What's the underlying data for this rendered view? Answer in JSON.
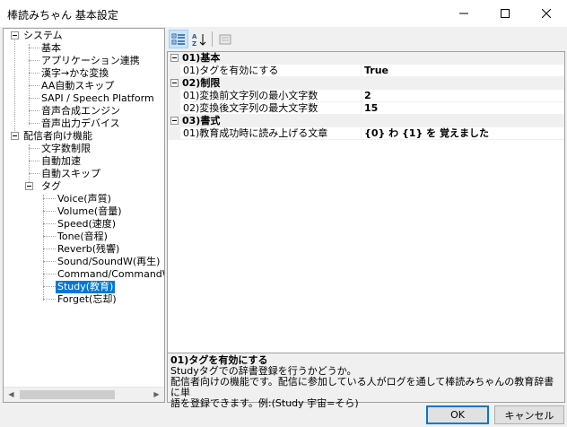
{
  "window": {
    "title": "棒読みちゃん 基本設定"
  },
  "tree": {
    "nodes": [
      {
        "label": "システム"
      },
      {
        "label": "基本"
      },
      {
        "label": "アプリケーション連携"
      },
      {
        "label": "漢字→かな変換"
      },
      {
        "label": "AA自動スキップ"
      },
      {
        "label": "SAPI / Speech Platform"
      },
      {
        "label": "音声合成エンジン"
      },
      {
        "label": "音声出力デバイス"
      },
      {
        "label": "配信者向け機能"
      },
      {
        "label": "文字数制限"
      },
      {
        "label": "自動加速"
      },
      {
        "label": "自動スキップ"
      },
      {
        "label": "タグ"
      },
      {
        "label": "Voice(声質)"
      },
      {
        "label": "Volume(音量)"
      },
      {
        "label": "Speed(速度)"
      },
      {
        "label": "Tone(音程)"
      },
      {
        "label": "Reverb(残響)"
      },
      {
        "label": "Sound/SoundW(再生)"
      },
      {
        "label": "Command/CommandW"
      },
      {
        "label": "Study(教育)"
      },
      {
        "label": "Forget(忘却)"
      }
    ],
    "selected": "Study(教育)"
  },
  "property_grid": {
    "categories": [
      {
        "label": "01)基本",
        "props": [
          {
            "name": "01)タグを有効にする",
            "value": "True"
          }
        ]
      },
      {
        "label": "02)制限",
        "props": [
          {
            "name": "01)変換前文字列の最小文字数",
            "value": "2"
          },
          {
            "name": "02)変換後文字列の最大文字数",
            "value": "15"
          }
        ]
      },
      {
        "label": "03)書式",
        "props": [
          {
            "name": "01)教育成功時に読み上げる文章",
            "value": "{0} わ {1} を 覚えました"
          }
        ]
      }
    ]
  },
  "description": {
    "title": "01)タグを有効にする",
    "line1": "Studyタグでの辞書登録を行うかどうか。",
    "line2": "配信者向けの機能です。配信に参加している人がログを通して棒読みちゃんの教育辞書に単",
    "line3": "語を登録できます。例:(Study 宇宙=そら)"
  },
  "buttons": {
    "ok": "OK",
    "cancel": "キャンセル"
  },
  "scrollbar": {
    "left_arrow": "◀",
    "right_arrow": "▶"
  }
}
